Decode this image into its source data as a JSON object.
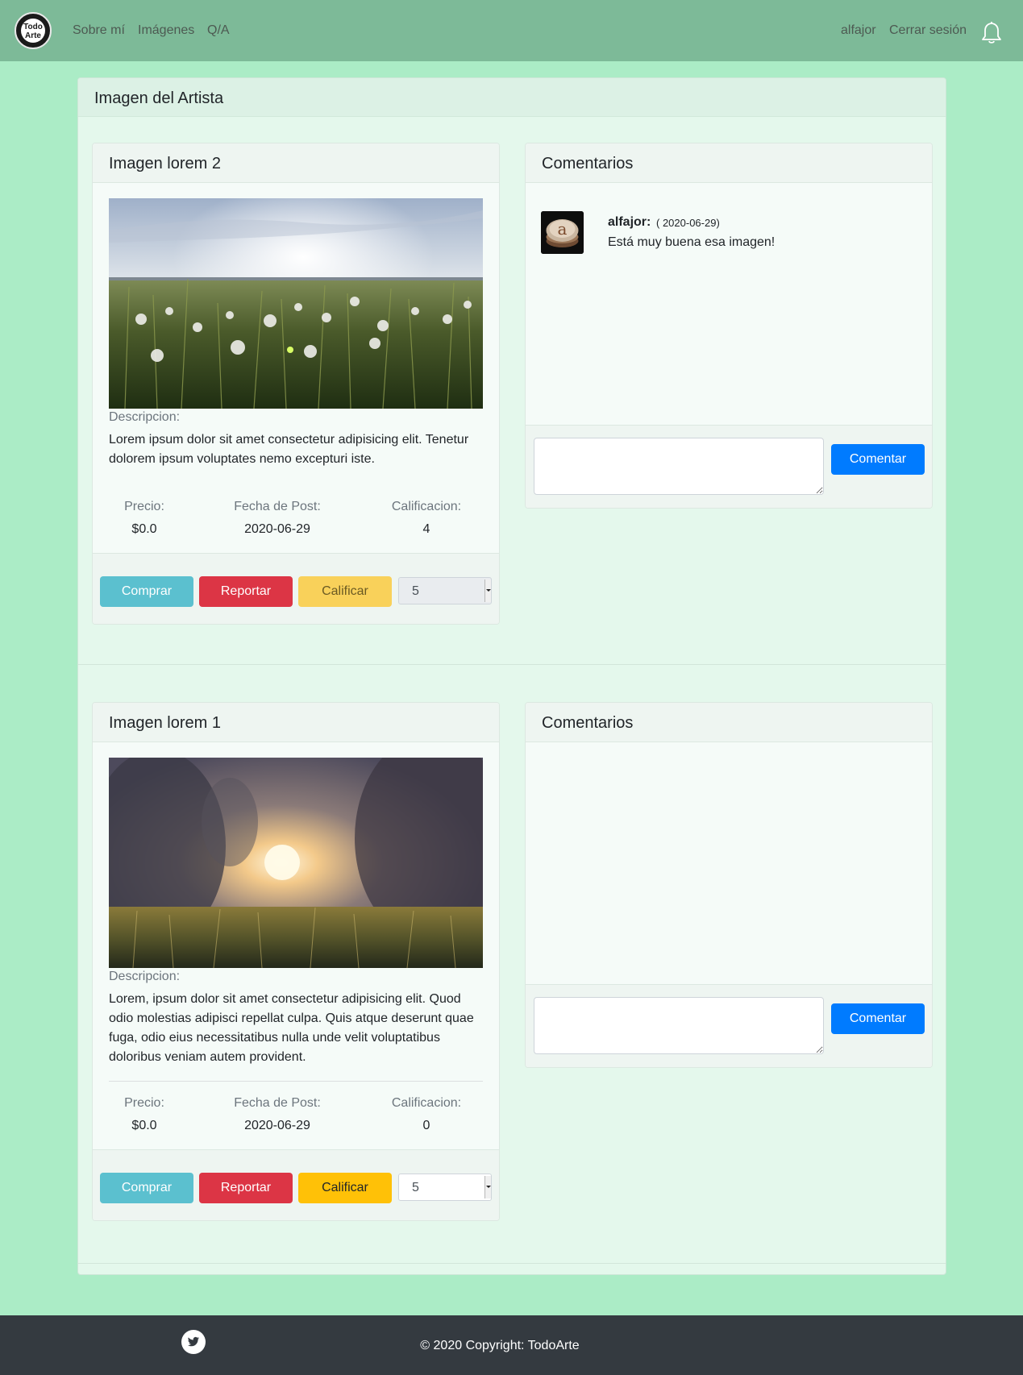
{
  "nav": {
    "logo_text_top": "Todo",
    "logo_text_bottom": "Arte",
    "links": [
      "Sobre mí",
      "Imágenes",
      "Q/A"
    ],
    "user": "alfajor",
    "logout": "Cerrar sesión",
    "notification_icon": "bell-icon"
  },
  "page": {
    "title": "Imagen del Artista"
  },
  "posts": [
    {
      "title": "Imagen lorem 2",
      "desc_label": "Descripcion:",
      "description": "Lorem ipsum dolor sit amet consectetur adipisicing elit. Tenetur dolorem ipsum voluptates nemo excepturi iste.",
      "price_label": "Precio:",
      "price": "$0.0",
      "date_label": "Fecha de Post:",
      "date": "2020-06-29",
      "rating_label": "Calificacion:",
      "rating": "4",
      "buy": "Comprar",
      "report": "Reportar",
      "rate": "Calificar",
      "rating_select": "5",
      "comments_title": "Comentarios",
      "comments": [
        {
          "author": "alfajor:",
          "date": "( 2020-06-29)",
          "text": "Está muy buena esa imagen!"
        }
      ],
      "comment_button": "Comentar"
    },
    {
      "title": "Imagen lorem 1",
      "desc_label": "Descripcion:",
      "description": "Lorem, ipsum dolor sit amet consectetur adipisicing elit. Quod odio molestias adipisci repellat culpa. Quis atque deserunt quae fuga, odio eius necessitatibus nulla unde velit voluptatibus doloribus veniam autem provident.",
      "price_label": "Precio:",
      "price": "$0.0",
      "date_label": "Fecha de Post:",
      "date": "2020-06-29",
      "rating_label": "Calificacion:",
      "rating": "0",
      "buy": "Comprar",
      "report": "Reportar",
      "rate": "Calificar",
      "rating_select": "5",
      "comments_title": "Comentarios",
      "comments": [],
      "comment_button": "Comentar"
    }
  ],
  "footer": {
    "social_icon": "twitter-icon",
    "copyright": "© 2020 Copyright: TodoArte"
  },
  "colors": {
    "page_bg": "#abecc6",
    "navbar": "#7dba98",
    "card_bg": "#e4f8ec",
    "footer": "#343a40",
    "info": "#5bc0cf",
    "danger": "#dc3545",
    "warning": "#ffc107",
    "primary": "#007bff"
  }
}
